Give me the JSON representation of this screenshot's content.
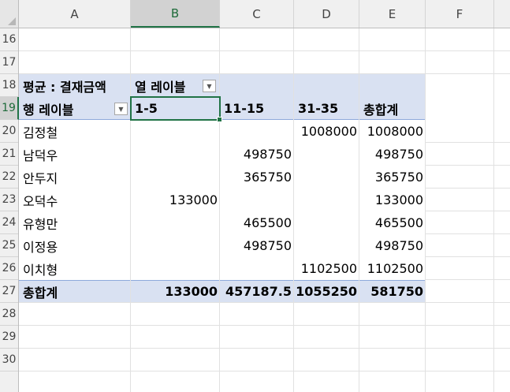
{
  "columns": [
    "A",
    "B",
    "C",
    "D",
    "E",
    "F"
  ],
  "rows": [
    "16",
    "17",
    "18",
    "19",
    "20",
    "21",
    "22",
    "23",
    "24",
    "25",
    "26",
    "27",
    "28",
    "29",
    "30"
  ],
  "selected_cell": {
    "column": "B",
    "row": "19"
  },
  "pivot": {
    "value_field_label": "평균 : 결재금액",
    "column_labels_header": "열 레이블",
    "row_labels_header": "행 레이블",
    "column_groups": [
      "1-5",
      "11-15",
      "31-35"
    ],
    "grand_total_label": "총합계",
    "rows": [
      {
        "label": "김정철",
        "c1": "",
        "c2": "",
        "c3": "1008000",
        "total": "1008000"
      },
      {
        "label": "남덕우",
        "c1": "",
        "c2": "498750",
        "c3": "",
        "total": "498750"
      },
      {
        "label": "안두지",
        "c1": "",
        "c2": "365750",
        "c3": "",
        "total": "365750"
      },
      {
        "label": "오덕수",
        "c1": "133000",
        "c2": "",
        "c3": "",
        "total": "133000"
      },
      {
        "label": "유형만",
        "c1": "",
        "c2": "465500",
        "c3": "",
        "total": "465500"
      },
      {
        "label": "이정용",
        "c1": "",
        "c2": "498750",
        "c3": "",
        "total": "498750"
      },
      {
        "label": "이치형",
        "c1": "",
        "c2": "",
        "c3": "1102500",
        "total": "1102500"
      }
    ],
    "grand_total": {
      "c1": "133000",
      "c2": "457187.5",
      "c3": "1055250",
      "total": "581750"
    }
  },
  "colors": {
    "band": "#d9e1f2",
    "selection": "#217346"
  }
}
